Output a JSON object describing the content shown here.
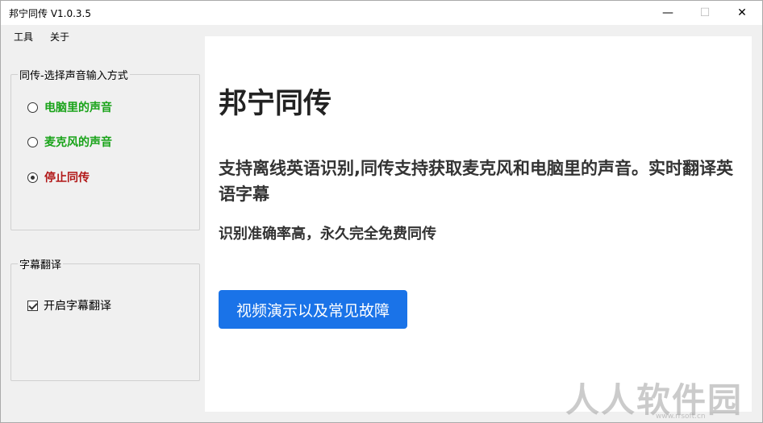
{
  "window": {
    "title": "邦宁同传 V1.0.3.5",
    "min_glyph": "—",
    "max_glyph": "☐",
    "close_glyph": "✕"
  },
  "menu": {
    "items": [
      "工具",
      "关于"
    ]
  },
  "input_group": {
    "legend": "同传-选择声音输入方式",
    "options": [
      {
        "label": "电脑里的声音",
        "checked": false
      },
      {
        "label": "麦克风的声音",
        "checked": false
      },
      {
        "label": "停止同传",
        "checked": true
      }
    ]
  },
  "subtitle_group": {
    "legend": "字幕翻译",
    "checkbox_label": "开启字幕翻译",
    "checked": true
  },
  "main": {
    "heading": "邦宁同传",
    "description": "支持离线英语识别,同传支持获取麦克风和电脑里的声音。实时翻译英语字幕",
    "subdescription": "识别准确率高，永久完全免费同传",
    "cta_label": "视频演示以及常见故障"
  },
  "watermark": {
    "text": "人人软件园",
    "sub": "www.rrsoft.cn"
  },
  "colors": {
    "option_green": "#19a319",
    "option_red": "#b11616",
    "cta_blue": "#1a73e8"
  }
}
